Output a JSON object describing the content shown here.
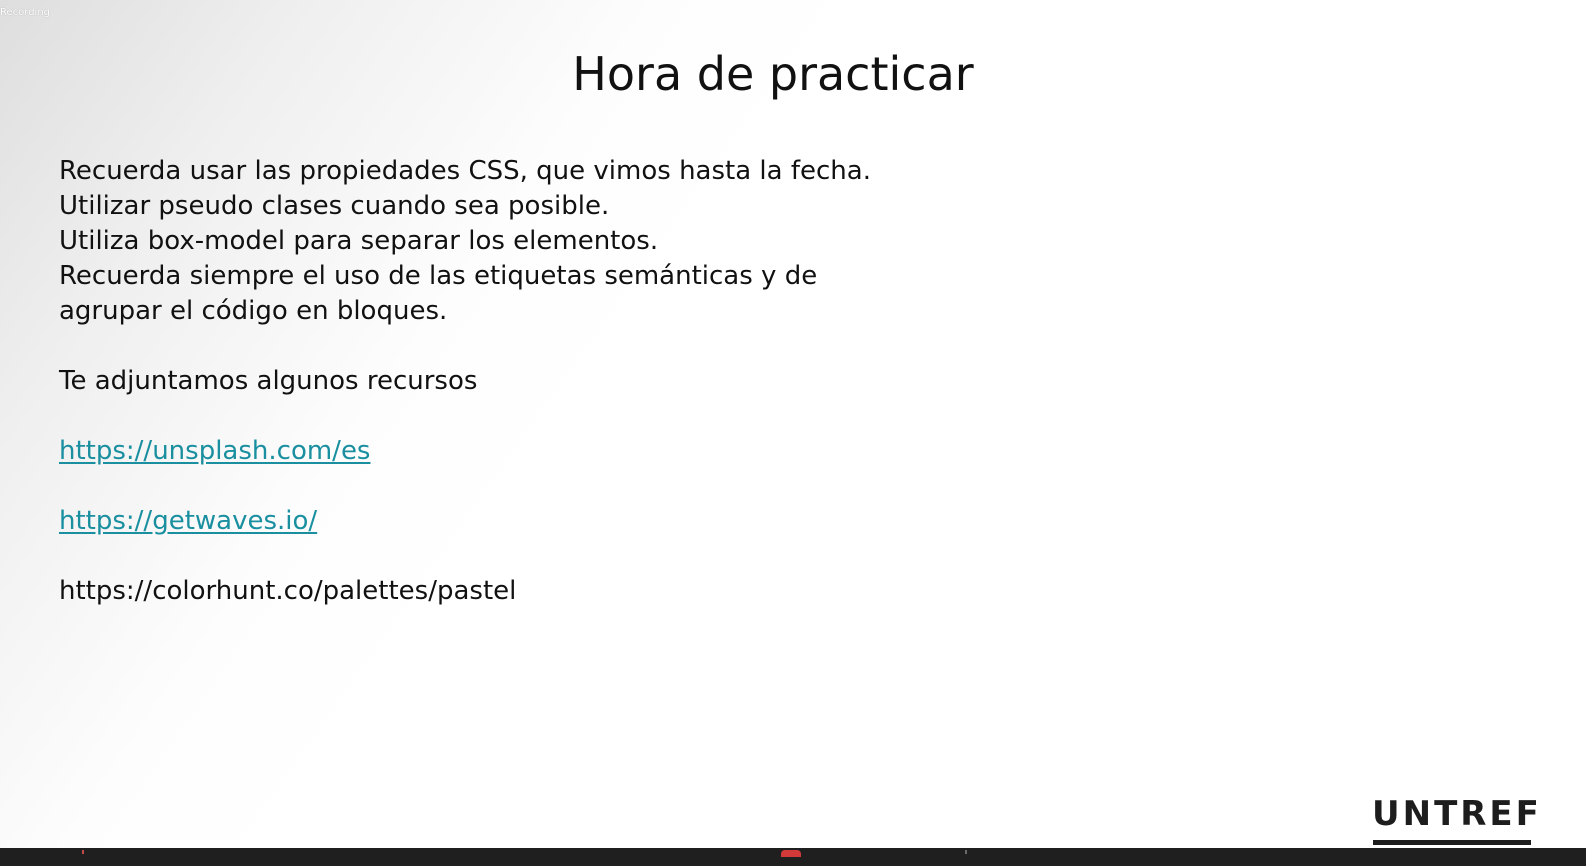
{
  "overlay": {
    "recording_label": "Recording"
  },
  "slide": {
    "title": "Hora de practicar",
    "lines": [
      "Recuerda usar las propiedades CSS, que vimos hasta la fecha.",
      "Utilizar pseudo clases cuando sea posible.",
      "Utiliza box-model para separar los elementos.",
      "Recuerda siempre el uso de las etiquetas semánticas y de agrupar el código en bloques."
    ],
    "resources_intro": "Te adjuntamos algunos recursos",
    "links": [
      "https://unsplash.com/es",
      "https://getwaves.io/"
    ],
    "plain_url": "https://colorhunt.co/palettes/pastel",
    "logo": "UNTREF"
  },
  "colors": {
    "link": "#1a8fa0",
    "text": "#111111",
    "taskbar": "#1f1f1f",
    "badge": "#d23a3a"
  }
}
